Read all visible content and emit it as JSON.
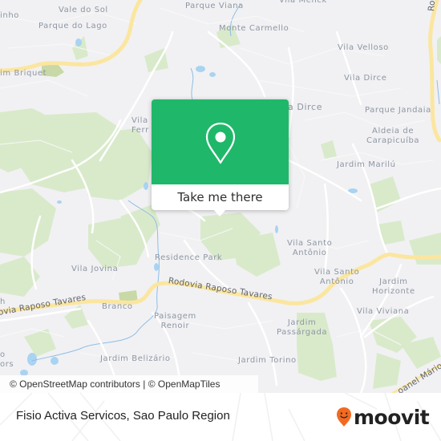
{
  "map": {
    "labels": {
      "vale_do_sol": "Vale do Sol",
      "parque_do_lago": "Parque do Lago",
      "inho": "inho",
      "jardim_briquet": "im Briquet",
      "parque_viana": "Parque Viana",
      "vila_menck": "Vila Menck",
      "monte_carmello": "Monte Carmello",
      "vila_velloso": "Vila Velloso",
      "vila_dirce_1": "Vila Dirce",
      "vila_dirce_2": "a Dirce",
      "parque_jandaia": "Parque Jandaia",
      "aldeia_line1": "Aldeia de",
      "aldeia_line2": "Carapicuíba",
      "vila_ferr_line1": "Vila",
      "vila_ferr_line2": "Ferr",
      "jardim_marilu": "Jardim Marilú",
      "vila_santo_antonio_1_line1": "Vila Santo",
      "vila_santo_antonio_1_line2": "Antônio",
      "vila_santo_antonio_2_line1": "Vila Santo",
      "vila_santo_antonio_2_line2": "Antônio",
      "residence_park": "Residence Park",
      "vila_jovina": "Vila Jovina",
      "jardim_horizonte_line1": "Jardim",
      "jardim_horizonte_line2": "Horizonte",
      "vila_viviana": "Vila Viviana",
      "branco": "Branco",
      "paisagem_line1": "Paisagem",
      "paisagem_line2": "Renoir",
      "jardim_passargada_line1": "Jardim",
      "jardim_passargada_line2": "Passárgada",
      "jardim_belizario": "Jardim Belizário",
      "jardim_torino": "Jardim Torino",
      "h_fragment": "h",
      "o_fragment": "o",
      "ors_fragment": "ors"
    },
    "roads": {
      "raposo_tavares_main": "Rodovia Raposo Tavares",
      "raposo_tavares_left": "ovia Raposo Tavares",
      "rodoanel": "oanel Mário",
      "rod_fragment": "Ro"
    },
    "attribution": "© OpenStreetMap contributors | © OpenMapTiles",
    "colors": {
      "land": "#f1f1f3",
      "park": "#d4e8c4",
      "water": "#a9d3f2",
      "highway": "#fbe7a1",
      "road": "#ffffff"
    }
  },
  "popup": {
    "icon": "map-pin-icon",
    "cta_label": "Take me there",
    "color": "#1fb86a"
  },
  "footer": {
    "place_name": "Fisio Activa Servicos, Sao Paulo Region",
    "brand": "moovit",
    "brand_icon": "moovit-smiley-pin-icon",
    "brand_color": "#f26a21"
  }
}
